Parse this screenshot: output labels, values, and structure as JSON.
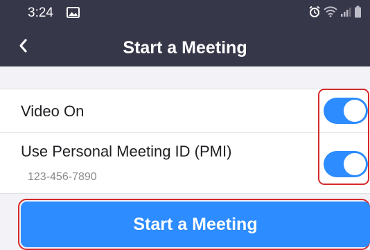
{
  "status_bar": {
    "time": "3:24",
    "icons": [
      "image-icon",
      "alarm-icon",
      "wifi-icon",
      "signal-icon",
      "battery-icon"
    ]
  },
  "header": {
    "title": "Start a Meeting",
    "back_icon": "chevron-left-icon"
  },
  "settings": {
    "video_on": {
      "label": "Video On",
      "enabled": true
    },
    "pmi": {
      "label": "Use Personal Meeting ID (PMI)",
      "meeting_id": "123-456-7890",
      "enabled": true
    }
  },
  "start_button": {
    "label": "Start a Meeting"
  },
  "colors": {
    "header_bg": "#37374a",
    "accent": "#2d8cff",
    "highlight": "#d42a2a",
    "page_bg": "#f2f2f7"
  }
}
